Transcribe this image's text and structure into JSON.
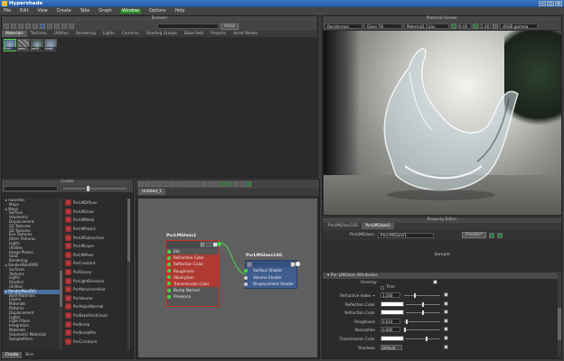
{
  "app": {
    "title": "Hypershade"
  },
  "menu": [
    "File",
    "Edit",
    "View",
    "Create",
    "Tabs",
    "Graph",
    "Window",
    "Options",
    "Help"
  ],
  "menu_active_index": 6,
  "browser": {
    "title": "Browser",
    "show_label": "Show",
    "tabs": [
      "Materials",
      "Textures",
      "Utilities",
      "Rendering",
      "Lights",
      "Cameras",
      "Shading Groups",
      "Bake Sets",
      "Projects",
      "Asset Nodes"
    ],
    "swatches": [
      "PxrL...",
      "lamb...",
      "parti...",
      "shad..."
    ]
  },
  "create": {
    "title": "Create",
    "tree": [
      {
        "label": "Favorites",
        "indent": 0
      },
      {
        "label": "Maya",
        "indent": 1
      },
      {
        "label": "Maya",
        "indent": 0
      },
      {
        "label": "Surface",
        "indent": 1
      },
      {
        "label": "Volumetric",
        "indent": 1
      },
      {
        "label": "Displacement",
        "indent": 1
      },
      {
        "label": "2D Textures",
        "indent": 1
      },
      {
        "label": "3D Textures",
        "indent": 1
      },
      {
        "label": "Env Textures",
        "indent": 1
      },
      {
        "label": "Other Textures",
        "indent": 1
      },
      {
        "label": "Lights",
        "indent": 1
      },
      {
        "label": "Utilities",
        "indent": 1
      },
      {
        "label": "Image Planes",
        "indent": 1
      },
      {
        "label": "Glow",
        "indent": 1
      },
      {
        "label": "Rendering",
        "indent": 1
      },
      {
        "label": "RenderMan/RMS",
        "indent": 0
      },
      {
        "label": "Surfaces",
        "indent": 1
      },
      {
        "label": "Textures",
        "indent": 1
      },
      {
        "label": "Lights",
        "indent": 1
      },
      {
        "label": "Shaders",
        "indent": 1
      },
      {
        "label": "Utilities",
        "indent": 1
      },
      {
        "label": "RenderMan/RIS",
        "indent": 0
      },
      {
        "label": "Bxdf Materials",
        "indent": 1
      },
      {
        "label": "Layers",
        "indent": 1
      },
      {
        "label": "Materials",
        "indent": 1
      },
      {
        "label": "Patterns",
        "indent": 1
      },
      {
        "label": "Displacement",
        "indent": 1
      },
      {
        "label": "Lights",
        "indent": 1
      },
      {
        "label": "Light Filters",
        "indent": 1
      },
      {
        "label": "Integrators",
        "indent": 1
      },
      {
        "label": "Materials",
        "indent": 1
      },
      {
        "label": "Volumetric Materials",
        "indent": 1
      },
      {
        "label": "Samplefilters",
        "indent": 1
      }
    ],
    "tree_selected_index": 21,
    "nodes": [
      "PxrLMDiffuse",
      "PxrLMGlass",
      "PxrLMMetal",
      "PxrLMPlastic",
      "PxrLMSubsurface",
      "PxrLMLayer",
      "PxrLMMixer",
      "PxrConstant",
      "PxrDisney",
      "PxrLightEmission",
      "PxrMarschnerHair",
      "PxrVolume",
      "PxrAdjustNormal",
      "PxrBakePointCloud",
      "PxrBump",
      "PxrBumpMix",
      "PxrCurvature"
    ],
    "bottom_tabs": [
      "Create",
      "Bins"
    ]
  },
  "node_editor": {
    "tab": "Untitled_1",
    "node1": {
      "name": "PxrLMGlass1",
      "ports": [
        "Eta",
        "Refraction Color",
        "Reflection Color",
        "Roughness",
        "Absorption",
        "Transmission Color",
        "Bump Normal",
        "Presence"
      ],
      "selected_ports": [
        1,
        2,
        3,
        4,
        5
      ]
    },
    "node2": {
      "name": "PxrLMGlass1SG",
      "ports": [
        "Surface Shader",
        "Volume Shader",
        "Displacement Shader"
      ]
    }
  },
  "material_viewer": {
    "title": "Material Viewer",
    "renderer": "Renderman",
    "geometry": "Glass Fill",
    "node": "Material1 Color",
    "exposure": "0.00",
    "gamma": "1.00",
    "colorspace": "sRGB gamma"
  },
  "property_editor": {
    "title": "Property Editor",
    "tabs": [
      "PxrLMGlass1SG",
      "PxrLMGlass1"
    ],
    "type_label": "PxrLMGlass:",
    "name_value": "PxrLMGlass1",
    "presets_label": "Presets*",
    "sample_label": "Sample",
    "section": "Pxr LMGlass Attributes",
    "overlay_label": "Overlay",
    "thin_label": "Thin",
    "attrs": [
      {
        "label": "Refractive Index →",
        "value": "1.500",
        "kind": "slider",
        "pos": 0.3
      },
      {
        "label": "Reflection Color",
        "kind": "color",
        "pos": 0.5
      },
      {
        "label": "Refraction Color",
        "kind": "color",
        "pos": 0.5
      },
      {
        "label": "Roughness",
        "value": "0.010",
        "kind": "slider",
        "pos": 0.05
      },
      {
        "label": "Absorption",
        "value": "0.000",
        "kind": "slider",
        "pos": 0.0
      },
      {
        "label": "Transmission Color",
        "kind": "color",
        "pos": 0.6
      },
      {
        "label": "Shadows",
        "value": "Default",
        "kind": "select"
      }
    ]
  }
}
